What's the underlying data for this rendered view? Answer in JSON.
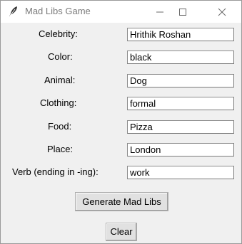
{
  "window": {
    "title": "Mad Libs Game",
    "icon": "feather-icon",
    "controls": [
      "minimize-icon",
      "maximize-icon",
      "close-icon"
    ]
  },
  "form": {
    "fields": [
      {
        "label": "Celebrity:",
        "value": "Hrithik Roshan"
      },
      {
        "label": "Color:",
        "value": "black"
      },
      {
        "label": "Animal:",
        "value": "Dog"
      },
      {
        "label": "Clothing:",
        "value": "formal"
      },
      {
        "label": "Food:",
        "value": "Pizza"
      },
      {
        "label": "Place:",
        "value": "London"
      },
      {
        "label": "Verb (ending in -ing):",
        "value": "work"
      }
    ]
  },
  "actions": {
    "generate_label": "Generate Mad Libs",
    "clear_label": "Clear"
  },
  "colors": {
    "window_bg": "#f0f0f0",
    "titlebar_bg": "#ffffff",
    "title_text": "#7a7a7a",
    "button_bg": "#e1e1e1",
    "input_border": "#7a7a7a"
  }
}
